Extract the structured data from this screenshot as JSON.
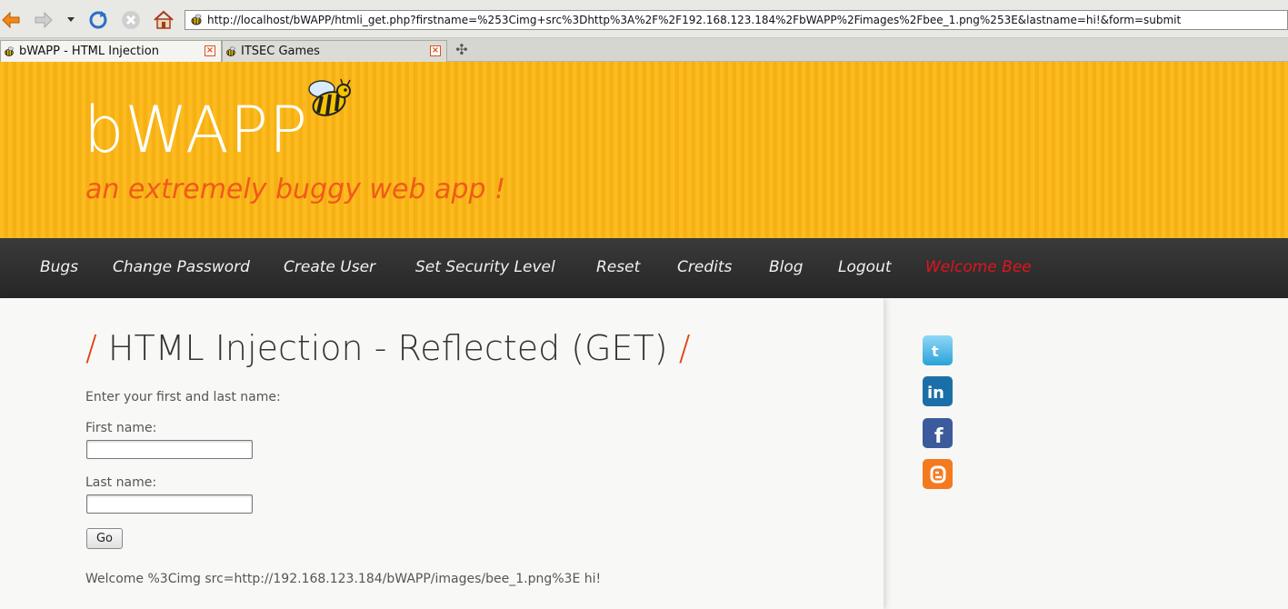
{
  "browser": {
    "url": "http://localhost/bWAPP/htmli_get.php?firstname=%253Cimg+src%3Dhttp%3A%2F%2F192.168.123.184%2FbWAPP%2Fimages%2Fbee_1.png%253E&lastname=hi!&form=submit",
    "tabs": [
      {
        "label": "bWAPP - HTML Injection",
        "active": true
      },
      {
        "label": "ITSEC Games",
        "active": false
      }
    ],
    "icons": [
      "back-icon",
      "forward-icon",
      "history-dropdown-icon",
      "reload-icon",
      "stop-icon",
      "home-icon",
      "new-tab-icon"
    ]
  },
  "header": {
    "logo": "bWAPP",
    "tagline": "an extremely buggy web app !"
  },
  "nav": {
    "items": [
      "Bugs",
      "Change Password",
      "Create User",
      "Set Security Level",
      "Reset",
      "Credits",
      "Blog",
      "Logout"
    ],
    "welcome": "Welcome Bee"
  },
  "main": {
    "title": "HTML Injection - Reflected (GET)",
    "title_slash": "/",
    "intro": "Enter your first and last name:",
    "first_label": "First name:",
    "first_value": "",
    "last_label": "Last name:",
    "last_value": "",
    "go_label": "Go",
    "result": "Welcome %3Cimg src=http://192.168.123.184/bWAPP/images/bee_1.png%3E hi!"
  },
  "social": {
    "icons": [
      "twitter-icon",
      "linkedin-icon",
      "facebook-icon",
      "blogger-icon"
    ]
  },
  "colors": {
    "header_bg": "#fdb714",
    "tagline": "#f05a1a",
    "nav_bg": "#2f2f2f",
    "welcome": "#e0141e",
    "title_slash": "#e04415"
  }
}
